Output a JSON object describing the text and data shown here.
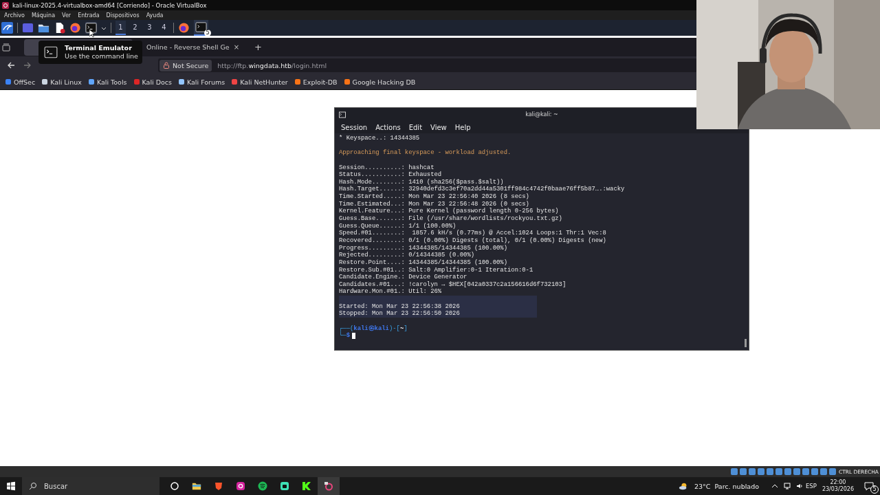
{
  "window": {
    "title": "kali-linux-2025.4-virtualbox-amd64 [Corriendo] - Oracle VirtualBox"
  },
  "menu": [
    "Archivo",
    "Máquina",
    "Ver",
    "Entrada",
    "Dispositivos",
    "Ayuda"
  ],
  "panel": {
    "workspaces": [
      {
        "label": "1",
        "selected": true
      },
      {
        "label": "2",
        "selected": false
      },
      {
        "label": "3",
        "selected": false
      },
      {
        "label": "4",
        "selected": false
      }
    ],
    "terminal_badge": "5"
  },
  "tooltip": {
    "title": "Terminal Emulator",
    "text": "Use the command line"
  },
  "browser": {
    "tabs": [
      {
        "label": "Online - Reverse Shell Ge",
        "close": "×"
      }
    ],
    "new_tab": "+",
    "security": "Not Secure",
    "url": {
      "prefix": "http://ftp.",
      "domain": "wingdata.htb",
      "path": "/login.html"
    },
    "bookmarks": [
      {
        "label": "OffSec",
        "color": "#3b82f6"
      },
      {
        "label": "Kali Linux",
        "color": "#cbd5e1"
      },
      {
        "label": "Kali Tools",
        "color": "#60a5fa"
      },
      {
        "label": "Kali Docs",
        "color": "#dc2626"
      },
      {
        "label": "Kali Forums",
        "color": "#93c5fd"
      },
      {
        "label": "Kali NetHunter",
        "color": "#ef4444"
      },
      {
        "label": "Exploit-DB",
        "color": "#f97316"
      },
      {
        "label": "Google Hacking DB",
        "color": "#f97316"
      }
    ]
  },
  "terminal": {
    "title": "kali@kali: ~",
    "menu": [
      "Session",
      "Actions",
      "Edit",
      "View",
      "Help"
    ],
    "blocks": [
      {
        "kind": "plain",
        "lines": [
          "* Keyspace..: 14344385"
        ]
      },
      {
        "kind": "warning",
        "lines": [
          "Approaching final keyspace - workload adjusted."
        ]
      },
      {
        "kind": "plain",
        "lines": [
          "Session..........: hashcat",
          "Status...........: Exhausted",
          "Hash.Mode........: 1410 (sha256($pass.$salt))",
          "Hash.Target......: 32940defd3c3ef70a2dd44a5301ff984c4742f0baae76ff5b87….:wacky",
          "Time.Started.....: Mon Mar 23 22:56:40 2026 (8 secs)",
          "Time.Estimated...: Mon Mar 23 22:56:48 2026 (0 secs)",
          "Kernel.Feature...: Pure Kernel (password length 0-256 bytes)",
          "Guess.Base.......: File (/usr/share/wordlists/rockyou.txt.gz)",
          "Guess.Queue......: 1/1 (100.00%)",
          "Speed.#01........:  1857.6 kH/s (0.77ms) @ Accel:1024 Loops:1 Thr:1 Vec:8",
          "Recovered........: 0/1 (0.00%) Digests (total), 0/1 (0.00%) Digests (new)",
          "Progress.........: 14344385/14344385 (100.00%)",
          "Rejected.........: 0/14344385 (0.00%)",
          "Restore.Point....: 14344385/14344385 (100.00%)",
          "Restore.Sub.#01..: Salt:0 Amplifier:0-1 Iteration:0-1",
          "Candidate.Engine.: Device Generator",
          "Candidates.#01...: !carolyn → $HEX[042a0337c2a156616d6f732103]",
          "Hardware.Mon.#01.: Util: 26%"
        ]
      },
      {
        "kind": "selected",
        "lines": [
          "Started: Mon Mar 23 22:56:38 2026",
          "Stopped: Mon Mar 23 22:56:50 2026"
        ]
      }
    ],
    "prompt": {
      "open": "┌──(",
      "user_host": "kali㉿kali",
      "mid": ")-[",
      "dir": "~",
      "close": "]",
      "corner": "└─",
      "symbol": "$"
    }
  },
  "vbox_status": "CTRL DERECHA",
  "taskbar": {
    "search": "Buscar",
    "weather": "23°C  Parc. nublado",
    "language": "ESP",
    "time": "22:00",
    "date": "23/03/2026",
    "notifications": "5"
  }
}
